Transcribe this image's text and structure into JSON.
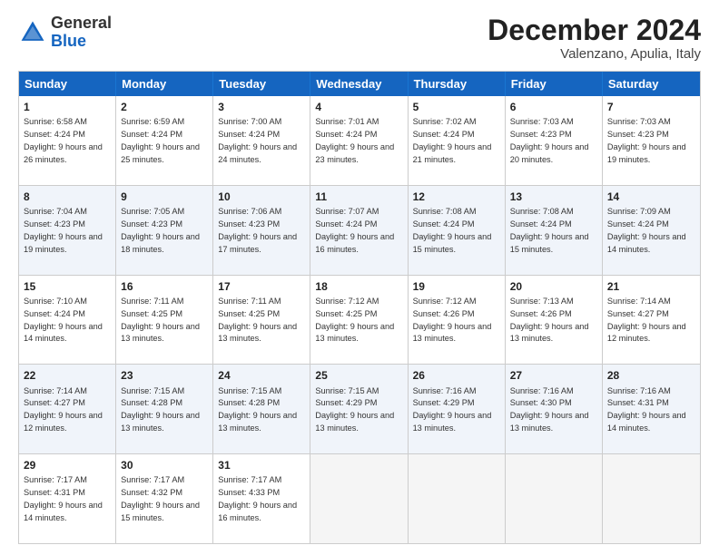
{
  "header": {
    "logo_general": "General",
    "logo_blue": "Blue",
    "month_title": "December 2024",
    "location": "Valenzano, Apulia, Italy"
  },
  "weekdays": [
    "Sunday",
    "Monday",
    "Tuesday",
    "Wednesday",
    "Thursday",
    "Friday",
    "Saturday"
  ],
  "rows": [
    {
      "alt": false,
      "cells": [
        {
          "day": "1",
          "sunrise": "6:58 AM",
          "sunset": "4:24 PM",
          "daylight": "9 hours and 26 minutes."
        },
        {
          "day": "2",
          "sunrise": "6:59 AM",
          "sunset": "4:24 PM",
          "daylight": "9 hours and 25 minutes."
        },
        {
          "day": "3",
          "sunrise": "7:00 AM",
          "sunset": "4:24 PM",
          "daylight": "9 hours and 24 minutes."
        },
        {
          "day": "4",
          "sunrise": "7:01 AM",
          "sunset": "4:24 PM",
          "daylight": "9 hours and 23 minutes."
        },
        {
          "day": "5",
          "sunrise": "7:02 AM",
          "sunset": "4:24 PM",
          "daylight": "9 hours and 21 minutes."
        },
        {
          "day": "6",
          "sunrise": "7:03 AM",
          "sunset": "4:23 PM",
          "daylight": "9 hours and 20 minutes."
        },
        {
          "day": "7",
          "sunrise": "7:03 AM",
          "sunset": "4:23 PM",
          "daylight": "9 hours and 19 minutes."
        }
      ]
    },
    {
      "alt": true,
      "cells": [
        {
          "day": "8",
          "sunrise": "7:04 AM",
          "sunset": "4:23 PM",
          "daylight": "9 hours and 19 minutes."
        },
        {
          "day": "9",
          "sunrise": "7:05 AM",
          "sunset": "4:23 PM",
          "daylight": "9 hours and 18 minutes."
        },
        {
          "day": "10",
          "sunrise": "7:06 AM",
          "sunset": "4:23 PM",
          "daylight": "9 hours and 17 minutes."
        },
        {
          "day": "11",
          "sunrise": "7:07 AM",
          "sunset": "4:24 PM",
          "daylight": "9 hours and 16 minutes."
        },
        {
          "day": "12",
          "sunrise": "7:08 AM",
          "sunset": "4:24 PM",
          "daylight": "9 hours and 15 minutes."
        },
        {
          "day": "13",
          "sunrise": "7:08 AM",
          "sunset": "4:24 PM",
          "daylight": "9 hours and 15 minutes."
        },
        {
          "day": "14",
          "sunrise": "7:09 AM",
          "sunset": "4:24 PM",
          "daylight": "9 hours and 14 minutes."
        }
      ]
    },
    {
      "alt": false,
      "cells": [
        {
          "day": "15",
          "sunrise": "7:10 AM",
          "sunset": "4:24 PM",
          "daylight": "9 hours and 14 minutes."
        },
        {
          "day": "16",
          "sunrise": "7:11 AM",
          "sunset": "4:25 PM",
          "daylight": "9 hours and 13 minutes."
        },
        {
          "day": "17",
          "sunrise": "7:11 AM",
          "sunset": "4:25 PM",
          "daylight": "9 hours and 13 minutes."
        },
        {
          "day": "18",
          "sunrise": "7:12 AM",
          "sunset": "4:25 PM",
          "daylight": "9 hours and 13 minutes."
        },
        {
          "day": "19",
          "sunrise": "7:12 AM",
          "sunset": "4:26 PM",
          "daylight": "9 hours and 13 minutes."
        },
        {
          "day": "20",
          "sunrise": "7:13 AM",
          "sunset": "4:26 PM",
          "daylight": "9 hours and 13 minutes."
        },
        {
          "day": "21",
          "sunrise": "7:14 AM",
          "sunset": "4:27 PM",
          "daylight": "9 hours and 12 minutes."
        }
      ]
    },
    {
      "alt": true,
      "cells": [
        {
          "day": "22",
          "sunrise": "7:14 AM",
          "sunset": "4:27 PM",
          "daylight": "9 hours and 12 minutes."
        },
        {
          "day": "23",
          "sunrise": "7:15 AM",
          "sunset": "4:28 PM",
          "daylight": "9 hours and 13 minutes."
        },
        {
          "day": "24",
          "sunrise": "7:15 AM",
          "sunset": "4:28 PM",
          "daylight": "9 hours and 13 minutes."
        },
        {
          "day": "25",
          "sunrise": "7:15 AM",
          "sunset": "4:29 PM",
          "daylight": "9 hours and 13 minutes."
        },
        {
          "day": "26",
          "sunrise": "7:16 AM",
          "sunset": "4:29 PM",
          "daylight": "9 hours and 13 minutes."
        },
        {
          "day": "27",
          "sunrise": "7:16 AM",
          "sunset": "4:30 PM",
          "daylight": "9 hours and 13 minutes."
        },
        {
          "day": "28",
          "sunrise": "7:16 AM",
          "sunset": "4:31 PM",
          "daylight": "9 hours and 14 minutes."
        }
      ]
    },
    {
      "alt": false,
      "cells": [
        {
          "day": "29",
          "sunrise": "7:17 AM",
          "sunset": "4:31 PM",
          "daylight": "9 hours and 14 minutes."
        },
        {
          "day": "30",
          "sunrise": "7:17 AM",
          "sunset": "4:32 PM",
          "daylight": "9 hours and 15 minutes."
        },
        {
          "day": "31",
          "sunrise": "7:17 AM",
          "sunset": "4:33 PM",
          "daylight": "9 hours and 16 minutes."
        },
        {
          "day": "",
          "sunrise": "",
          "sunset": "",
          "daylight": ""
        },
        {
          "day": "",
          "sunrise": "",
          "sunset": "",
          "daylight": ""
        },
        {
          "day": "",
          "sunrise": "",
          "sunset": "",
          "daylight": ""
        },
        {
          "day": "",
          "sunrise": "",
          "sunset": "",
          "daylight": ""
        }
      ]
    }
  ]
}
